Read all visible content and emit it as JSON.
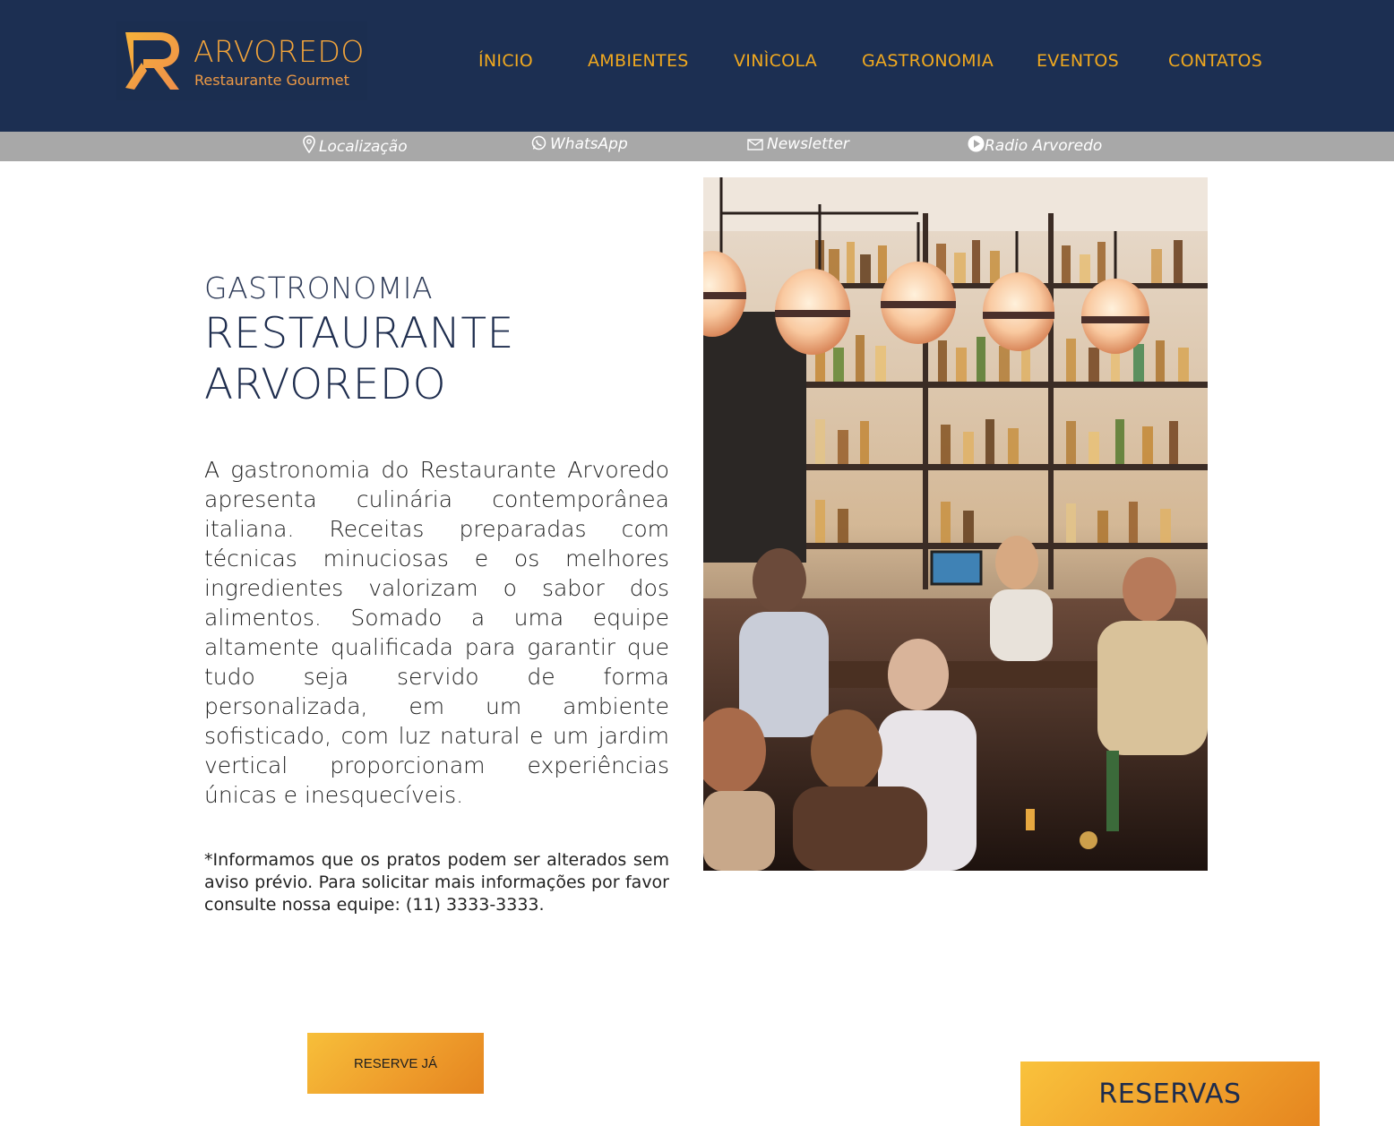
{
  "brand": {
    "name": "ARVOREDO",
    "tagline": "Restaurante Gourmet"
  },
  "nav": {
    "items": [
      "ÍNICIO",
      "AMBIENTES",
      "VINÌCOLA",
      "GASTRONOMIA",
      "EVENTOS",
      "CONTATOS"
    ]
  },
  "subbar": {
    "location": "Localização",
    "whatsapp": "WhatsApp",
    "newsletter": "Newsletter",
    "radio": "Radio Arvoredo"
  },
  "main": {
    "eyebrow": "GASTRONOMIA",
    "title": "RESTAURANTE ARVOREDO",
    "body": "A gastronomia do Restaurante Arvoredo apresenta culinária contemporânea italiana. Receitas preparadas com técnicas minuciosas e os melhores ingredientes valorizam o sabor dos alimentos. Somado a uma equipe altamente qualificada para garantir que tudo seja servido de forma personalizada, em um ambiente sofisticado, com luz natural e um jardim vertical proporcionam experiências únicas e inesquecíveis.",
    "note": "*Informamos que os pratos podem ser alterados sem aviso prévio. Para solicitar mais informações por favor consulte nossa equipe: (11) 3333-3333."
  },
  "buttons": {
    "reserve": "RESERVE JÁ",
    "reservas": "RESERVAS"
  },
  "colors": {
    "header_bg": "#1c2f52",
    "accent": "#f1a91f",
    "subbar_bg": "#a8a8a8"
  }
}
